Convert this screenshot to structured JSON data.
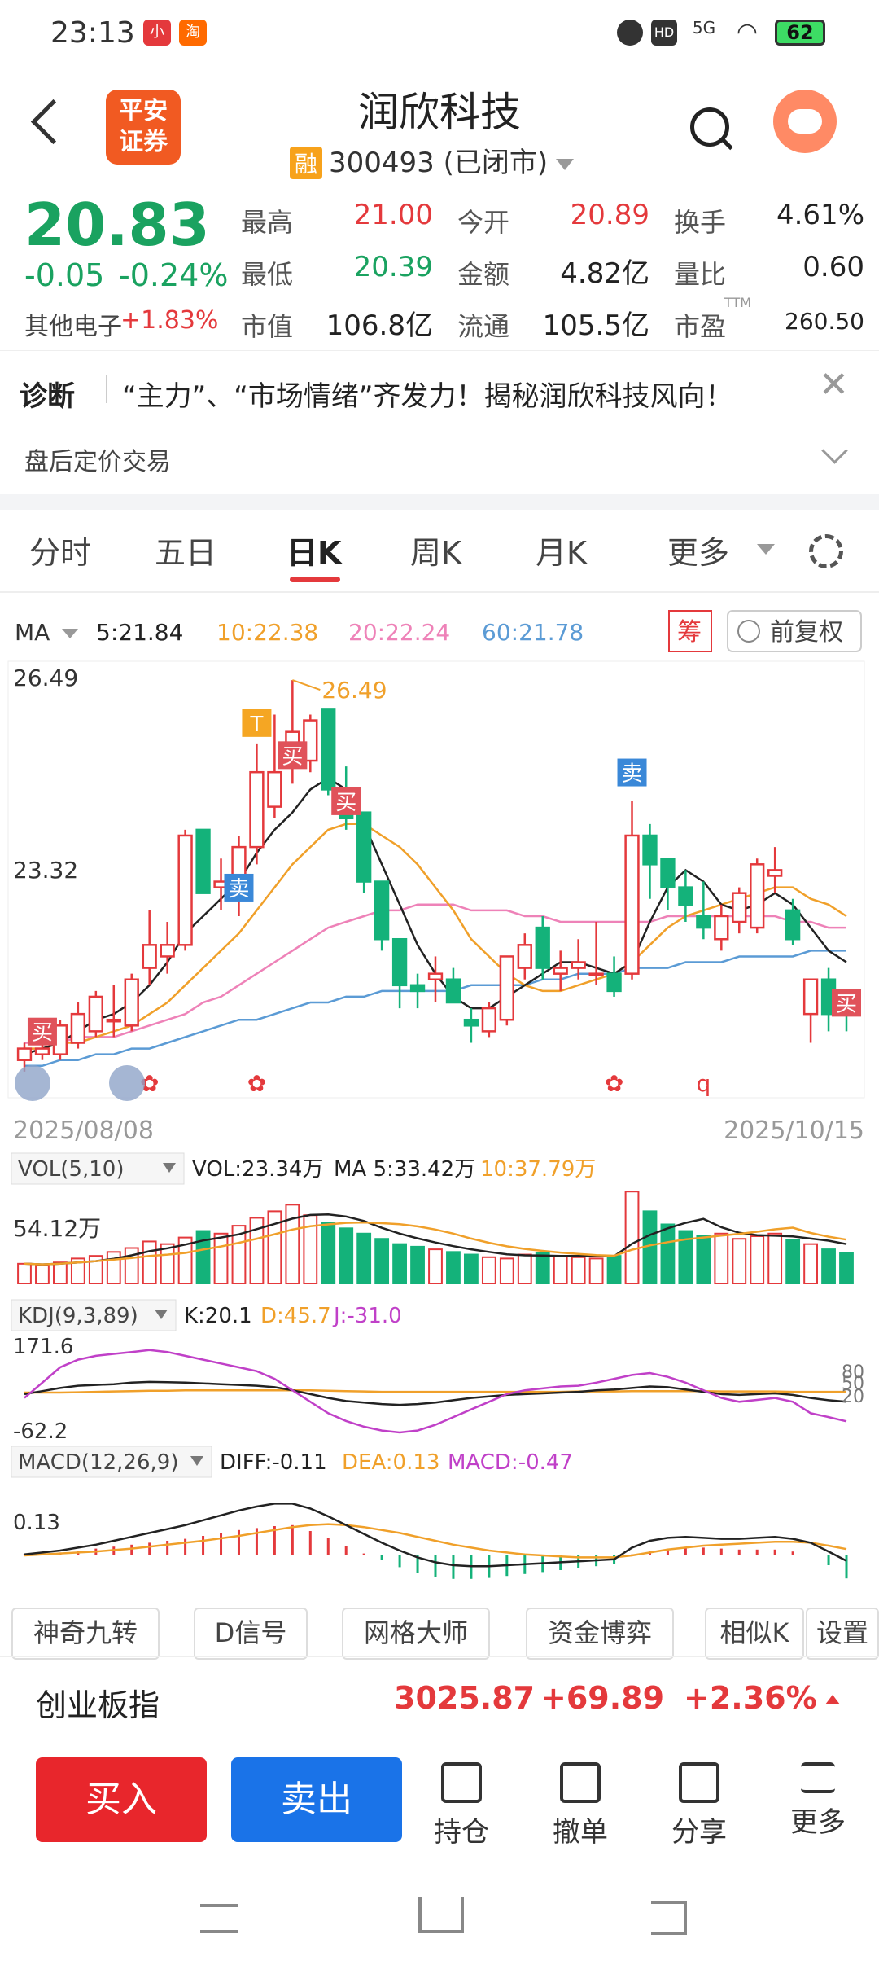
{
  "status_bar": {
    "time": "23:13",
    "network": "5G",
    "hd": "HD",
    "battery": "62"
  },
  "header": {
    "logo_line1": "平安",
    "logo_line2": "证券",
    "title": "润欣科技",
    "badge": "融",
    "code_status": "300493 (已闭市)"
  },
  "quote": {
    "price": "20.83",
    "change": "-0.05",
    "change_pct": "-0.24%",
    "sector_label": "其他电子",
    "sector_change": "+1.83%",
    "high_label": "最高",
    "high": "21.00",
    "open_label": "今开",
    "open": "20.89",
    "turnover_label": "换手",
    "turnover": "4.61%",
    "low_label": "最低",
    "low": "20.39",
    "amount_label": "金额",
    "amount": "4.82亿",
    "volratio_label": "量比",
    "volratio": "0.60",
    "mcap_label": "市值",
    "mcap": "106.8亿",
    "float_label": "流通",
    "float": "105.5亿",
    "pe_label": "市盈",
    "pe_sup": "TTM",
    "pe": "260.50"
  },
  "diagnosis": {
    "label": "诊断",
    "text": "“主力”、“市场情绪”齐发力！揭秘润欣科技风向！"
  },
  "after_hours": {
    "label": "盘后定价交易"
  },
  "tabs": [
    "分时",
    "五日",
    "日K",
    "周K",
    "月K",
    "更多"
  ],
  "ma_bar": {
    "ma": "MA",
    "ma5": "5:21.84",
    "ma10": "10:22.38",
    "ma20": "20:22.24",
    "ma60": "60:21.78",
    "chip_btn": "筹",
    "adj_btn": "前复权",
    "colors": {
      "ma5": "#222222",
      "ma10": "#f0a02a",
      "ma20": "#ee82b8",
      "ma60": "#5b9bd5"
    }
  },
  "chart_data": [
    {
      "type": "candlestick",
      "title": "日K",
      "x_start": "2025/08/08",
      "x_end": "2025/10/15",
      "y_ticks": [
        "26.49",
        "23.32"
      ],
      "max_marker": "26.49",
      "ohlc": [
        [
          19.9,
          20.2,
          19.7,
          20.1
        ],
        [
          20.0,
          20.3,
          19.9,
          20.1
        ],
        [
          20.0,
          20.6,
          19.9,
          20.5
        ],
        [
          20.2,
          20.9,
          20.1,
          20.7
        ],
        [
          20.4,
          21.1,
          20.3,
          21.0
        ],
        [
          20.6,
          21.2,
          20.3,
          20.6
        ],
        [
          20.5,
          21.4,
          20.4,
          21.3
        ],
        [
          21.5,
          22.5,
          21.2,
          21.9
        ],
        [
          21.7,
          22.3,
          21.4,
          21.9
        ],
        [
          21.9,
          23.9,
          21.8,
          23.8
        ],
        [
          23.9,
          23.9,
          22.8,
          22.8
        ],
        [
          22.9,
          23.4,
          22.5,
          23.0
        ],
        [
          22.8,
          23.8,
          22.4,
          23.6
        ],
        [
          23.6,
          25.4,
          23.3,
          24.9
        ],
        [
          24.3,
          25.9,
          24.1,
          24.9
        ],
        [
          25.0,
          26.5,
          24.7,
          25.6
        ],
        [
          25.1,
          25.9,
          24.9,
          25.8
        ],
        [
          26.0,
          26.0,
          24.5,
          24.6
        ],
        [
          24.6,
          25.0,
          23.9,
          24.1
        ],
        [
          24.2,
          24.2,
          22.8,
          23.0
        ],
        [
          23.0,
          23.0,
          21.8,
          22.0
        ],
        [
          22.0,
          22.0,
          20.8,
          21.2
        ],
        [
          21.2,
          21.4,
          20.8,
          21.1
        ],
        [
          21.3,
          21.7,
          20.9,
          21.4
        ],
        [
          21.3,
          21.5,
          20.9,
          20.9
        ],
        [
          20.6,
          20.8,
          20.2,
          20.5
        ],
        [
          20.4,
          20.9,
          20.3,
          20.8
        ],
        [
          20.6,
          21.7,
          20.5,
          21.7
        ],
        [
          21.5,
          22.1,
          21.3,
          21.9
        ],
        [
          22.2,
          22.4,
          21.3,
          21.5
        ],
        [
          21.4,
          21.8,
          21.1,
          21.5
        ],
        [
          21.5,
          22.0,
          21.3,
          21.6
        ],
        [
          21.4,
          22.3,
          21.2,
          21.4
        ],
        [
          21.4,
          21.7,
          21.0,
          21.1
        ],
        [
          21.4,
          24.4,
          21.3,
          23.8
        ],
        [
          23.8,
          24.0,
          22.7,
          23.3
        ],
        [
          23.4,
          23.4,
          22.5,
          22.9
        ],
        [
          22.9,
          23.2,
          22.3,
          22.6
        ],
        [
          22.4,
          23.0,
          22.0,
          22.2
        ],
        [
          22.0,
          22.6,
          21.8,
          22.4
        ],
        [
          22.3,
          22.9,
          22.1,
          22.8
        ],
        [
          22.2,
          23.4,
          22.1,
          23.3
        ],
        [
          23.1,
          23.6,
          22.8,
          23.2
        ],
        [
          22.5,
          22.7,
          21.9,
          22.0
        ],
        [
          20.7,
          21.2,
          20.2,
          21.3
        ],
        [
          21.3,
          21.5,
          20.4,
          20.7
        ],
        [
          20.9,
          21.0,
          20.4,
          20.8
        ]
      ],
      "ma5": [
        20.0,
        20.1,
        20.2,
        20.4,
        20.6,
        20.7,
        20.9,
        21.2,
        21.6,
        22.1,
        22.4,
        22.7,
        23.0,
        23.5,
        23.9,
        24.2,
        24.6,
        24.8,
        24.6,
        24.0,
        23.3,
        22.6,
        21.9,
        21.4,
        21.0,
        20.8,
        20.8,
        21.0,
        21.2,
        21.4,
        21.6,
        21.6,
        21.5,
        21.4,
        21.6,
        22.3,
        22.9,
        23.2,
        23.0,
        22.6,
        22.5,
        22.6,
        22.8,
        22.6,
        22.2,
        21.8,
        21.6
      ],
      "ma10": [
        20.1,
        20.1,
        20.2,
        20.2,
        20.3,
        20.4,
        20.5,
        20.7,
        20.9,
        21.2,
        21.5,
        21.8,
        22.1,
        22.5,
        22.9,
        23.3,
        23.6,
        23.9,
        24.0,
        24.0,
        23.8,
        23.6,
        23.3,
        22.9,
        22.5,
        22.0,
        21.7,
        21.4,
        21.2,
        21.1,
        21.1,
        21.2,
        21.3,
        21.4,
        21.6,
        21.9,
        22.2,
        22.4,
        22.5,
        22.6,
        22.7,
        22.8,
        22.9,
        22.9,
        22.7,
        22.6,
        22.4
      ],
      "ma20": [
        20.2,
        20.2,
        20.2,
        20.3,
        20.3,
        20.3,
        20.4,
        20.5,
        20.6,
        20.7,
        20.9,
        21.0,
        21.2,
        21.4,
        21.6,
        21.8,
        22.0,
        22.2,
        22.3,
        22.4,
        22.5,
        22.5,
        22.6,
        22.6,
        22.6,
        22.5,
        22.5,
        22.5,
        22.4,
        22.4,
        22.3,
        22.3,
        22.3,
        22.3,
        22.3,
        22.3,
        22.4,
        22.4,
        22.4,
        22.4,
        22.4,
        22.4,
        22.4,
        22.3,
        22.3,
        22.2,
        22.2
      ],
      "ma60": [
        19.8,
        19.8,
        19.9,
        19.9,
        20.0,
        20.0,
        20.1,
        20.1,
        20.2,
        20.3,
        20.4,
        20.5,
        20.6,
        20.6,
        20.7,
        20.8,
        20.9,
        20.9,
        21.0,
        21.0,
        21.1,
        21.1,
        21.1,
        21.1,
        21.1,
        21.2,
        21.2,
        21.2,
        21.2,
        21.3,
        21.3,
        21.4,
        21.4,
        21.4,
        21.5,
        21.5,
        21.5,
        21.6,
        21.6,
        21.6,
        21.7,
        21.7,
        21.7,
        21.7,
        21.8,
        21.8,
        21.8
      ],
      "signals": [
        {
          "index": 1,
          "label": "买",
          "color": "#e0525a"
        },
        {
          "index": 12,
          "label": "卖",
          "color": "#3a88d8"
        },
        {
          "index": 13,
          "label": "T",
          "color": "#f5a623"
        },
        {
          "index": 15,
          "label": "买",
          "color": "#e0525a"
        },
        {
          "index": 18,
          "label": "买",
          "color": "#e0525a"
        },
        {
          "index": 34,
          "label": "卖",
          "color": "#3a88d8"
        },
        {
          "index": 46,
          "label": "买",
          "color": "#e0525a"
        }
      ],
      "bottom_marks": [
        {
          "index": 4,
          "label": "✿"
        },
        {
          "index": 10,
          "label": "✿"
        },
        {
          "index": 23,
          "label": "✿"
        },
        {
          "index": 28,
          "label": "q"
        }
      ]
    },
    {
      "type": "bar",
      "title": "VOL(5,10)",
      "vol_text": "VOL:23.34万",
      "ma5_text": "MA 5:33.42万",
      "ma10_text": "10:37.79万",
      "y_tick": "54.12万",
      "values": [
        15,
        14,
        16,
        19,
        21,
        24,
        27,
        32,
        30,
        35,
        40,
        38,
        44,
        50,
        55,
        60,
        52,
        46,
        42,
        38,
        34,
        30,
        28,
        26,
        24,
        22,
        20,
        19,
        22,
        23,
        21,
        20,
        19,
        21,
        70,
        55,
        45,
        40,
        36,
        38,
        34,
        36,
        38,
        33,
        30,
        26,
        23
      ]
    },
    {
      "type": "line",
      "title": "KDJ(9,3,89)",
      "k_text": "K:20.1",
      "d_text": "D:45.7",
      "j_text": "J:-31.0",
      "y_top": "171.6",
      "y_bottom": "-62.2",
      "y_right": [
        "80",
        "50",
        "20"
      ],
      "k": [
        40,
        48,
        56,
        62,
        64,
        66,
        70,
        72,
        71,
        70,
        68,
        66,
        64,
        62,
        58,
        50,
        40,
        30,
        22,
        18,
        14,
        12,
        14,
        18,
        24,
        30,
        34,
        38,
        40,
        42,
        44,
        46,
        50,
        52,
        56,
        60,
        58,
        52,
        46,
        40,
        38,
        40,
        42,
        38,
        30,
        24,
        20
      ],
      "d": [
        44,
        44,
        44,
        45,
        46,
        47,
        48,
        49,
        49,
        50,
        50,
        50,
        50,
        50,
        50,
        50,
        50,
        49,
        48,
        47,
        46,
        46,
        46,
        46,
        46,
        46,
        46,
        46,
        46,
        46,
        46,
        47,
        47,
        47,
        48,
        48,
        48,
        48,
        48,
        47,
        47,
        47,
        47,
        46,
        46,
        46,
        46
      ],
      "j": [
        30,
        70,
        110,
        130,
        140,
        145,
        150,
        155,
        150,
        140,
        130,
        120,
        110,
        100,
        80,
        50,
        20,
        -10,
        -30,
        -45,
        -55,
        -60,
        -55,
        -40,
        -20,
        0,
        20,
        40,
        50,
        55,
        60,
        62,
        70,
        80,
        90,
        95,
        85,
        70,
        50,
        30,
        20,
        25,
        30,
        20,
        -10,
        -20,
        -31
      ]
    },
    {
      "type": "bar",
      "title": "MACD(12,26,9)",
      "diff_text": "DIFF:-0.11",
      "dea_text": "DEA:0.13",
      "macd_text": "MACD:-0.47",
      "y_tick": "0.13",
      "macd": [
        0.02,
        0.04,
        0.06,
        0.1,
        0.14,
        0.18,
        0.22,
        0.26,
        0.3,
        0.34,
        0.4,
        0.46,
        0.52,
        0.56,
        0.6,
        0.62,
        0.5,
        0.36,
        0.2,
        0.04,
        -0.1,
        -0.24,
        -0.36,
        -0.44,
        -0.48,
        -0.48,
        -0.46,
        -0.42,
        -0.38,
        -0.34,
        -0.3,
        -0.26,
        -0.22,
        -0.18,
        0.02,
        0.1,
        0.14,
        0.16,
        0.16,
        0.14,
        0.12,
        0.12,
        0.12,
        0.08,
        0.0,
        -0.2,
        -0.47
      ],
      "diff": [
        0.02,
        0.06,
        0.1,
        0.16,
        0.22,
        0.3,
        0.38,
        0.46,
        0.54,
        0.62,
        0.72,
        0.82,
        0.92,
        1.0,
        1.06,
        1.06,
        0.96,
        0.8,
        0.62,
        0.44,
        0.26,
        0.1,
        -0.04,
        -0.14,
        -0.2,
        -0.22,
        -0.22,
        -0.2,
        -0.18,
        -0.16,
        -0.14,
        -0.12,
        -0.1,
        -0.08,
        0.16,
        0.3,
        0.36,
        0.38,
        0.36,
        0.34,
        0.34,
        0.36,
        0.38,
        0.34,
        0.26,
        0.08,
        -0.11
      ],
      "dea": [
        0.0,
        0.02,
        0.04,
        0.06,
        0.08,
        0.11,
        0.14,
        0.18,
        0.22,
        0.26,
        0.3,
        0.35,
        0.4,
        0.46,
        0.52,
        0.58,
        0.62,
        0.64,
        0.62,
        0.58,
        0.52,
        0.46,
        0.38,
        0.3,
        0.22,
        0.16,
        0.1,
        0.06,
        0.02,
        0.0,
        -0.02,
        -0.04,
        -0.04,
        -0.04,
        0.0,
        0.06,
        0.12,
        0.16,
        0.2,
        0.22,
        0.24,
        0.26,
        0.28,
        0.28,
        0.26,
        0.2,
        0.13
      ]
    }
  ],
  "tools": [
    "神奇九转",
    "D信号",
    "网格大师",
    "资金博弈",
    "相似K",
    "设置"
  ],
  "index_bar": {
    "name": "创业板指",
    "value": "3025.87",
    "change": "+69.89",
    "change_pct": "+2.36%"
  },
  "bottom_bar": {
    "buy": "买入",
    "sell": "卖出",
    "actions": [
      "持仓",
      "撤单",
      "分享",
      "更多"
    ]
  }
}
